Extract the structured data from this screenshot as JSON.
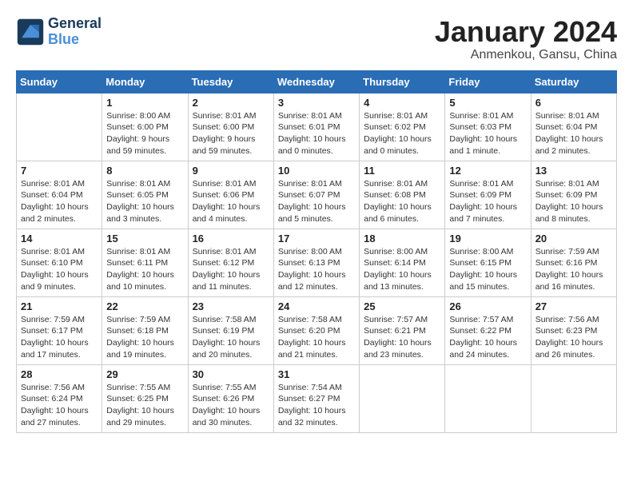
{
  "logo": {
    "line1": "General",
    "line2": "Blue"
  },
  "title": "January 2024",
  "subtitle": "Anmenkou, Gansu, China",
  "days_header": [
    "Sunday",
    "Monday",
    "Tuesday",
    "Wednesday",
    "Thursday",
    "Friday",
    "Saturday"
  ],
  "weeks": [
    [
      {
        "num": "",
        "info": ""
      },
      {
        "num": "1",
        "info": "Sunrise: 8:00 AM\nSunset: 6:00 PM\nDaylight: 9 hours\nand 59 minutes."
      },
      {
        "num": "2",
        "info": "Sunrise: 8:01 AM\nSunset: 6:00 PM\nDaylight: 9 hours\nand 59 minutes."
      },
      {
        "num": "3",
        "info": "Sunrise: 8:01 AM\nSunset: 6:01 PM\nDaylight: 10 hours\nand 0 minutes."
      },
      {
        "num": "4",
        "info": "Sunrise: 8:01 AM\nSunset: 6:02 PM\nDaylight: 10 hours\nand 0 minutes."
      },
      {
        "num": "5",
        "info": "Sunrise: 8:01 AM\nSunset: 6:03 PM\nDaylight: 10 hours\nand 1 minute."
      },
      {
        "num": "6",
        "info": "Sunrise: 8:01 AM\nSunset: 6:04 PM\nDaylight: 10 hours\nand 2 minutes."
      }
    ],
    [
      {
        "num": "7",
        "info": "Sunrise: 8:01 AM\nSunset: 6:04 PM\nDaylight: 10 hours\nand 2 minutes."
      },
      {
        "num": "8",
        "info": "Sunrise: 8:01 AM\nSunset: 6:05 PM\nDaylight: 10 hours\nand 3 minutes."
      },
      {
        "num": "9",
        "info": "Sunrise: 8:01 AM\nSunset: 6:06 PM\nDaylight: 10 hours\nand 4 minutes."
      },
      {
        "num": "10",
        "info": "Sunrise: 8:01 AM\nSunset: 6:07 PM\nDaylight: 10 hours\nand 5 minutes."
      },
      {
        "num": "11",
        "info": "Sunrise: 8:01 AM\nSunset: 6:08 PM\nDaylight: 10 hours\nand 6 minutes."
      },
      {
        "num": "12",
        "info": "Sunrise: 8:01 AM\nSunset: 6:09 PM\nDaylight: 10 hours\nand 7 minutes."
      },
      {
        "num": "13",
        "info": "Sunrise: 8:01 AM\nSunset: 6:09 PM\nDaylight: 10 hours\nand 8 minutes."
      }
    ],
    [
      {
        "num": "14",
        "info": "Sunrise: 8:01 AM\nSunset: 6:10 PM\nDaylight: 10 hours\nand 9 minutes."
      },
      {
        "num": "15",
        "info": "Sunrise: 8:01 AM\nSunset: 6:11 PM\nDaylight: 10 hours\nand 10 minutes."
      },
      {
        "num": "16",
        "info": "Sunrise: 8:01 AM\nSunset: 6:12 PM\nDaylight: 10 hours\nand 11 minutes."
      },
      {
        "num": "17",
        "info": "Sunrise: 8:00 AM\nSunset: 6:13 PM\nDaylight: 10 hours\nand 12 minutes."
      },
      {
        "num": "18",
        "info": "Sunrise: 8:00 AM\nSunset: 6:14 PM\nDaylight: 10 hours\nand 13 minutes."
      },
      {
        "num": "19",
        "info": "Sunrise: 8:00 AM\nSunset: 6:15 PM\nDaylight: 10 hours\nand 15 minutes."
      },
      {
        "num": "20",
        "info": "Sunrise: 7:59 AM\nSunset: 6:16 PM\nDaylight: 10 hours\nand 16 minutes."
      }
    ],
    [
      {
        "num": "21",
        "info": "Sunrise: 7:59 AM\nSunset: 6:17 PM\nDaylight: 10 hours\nand 17 minutes."
      },
      {
        "num": "22",
        "info": "Sunrise: 7:59 AM\nSunset: 6:18 PM\nDaylight: 10 hours\nand 19 minutes."
      },
      {
        "num": "23",
        "info": "Sunrise: 7:58 AM\nSunset: 6:19 PM\nDaylight: 10 hours\nand 20 minutes."
      },
      {
        "num": "24",
        "info": "Sunrise: 7:58 AM\nSunset: 6:20 PM\nDaylight: 10 hours\nand 21 minutes."
      },
      {
        "num": "25",
        "info": "Sunrise: 7:57 AM\nSunset: 6:21 PM\nDaylight: 10 hours\nand 23 minutes."
      },
      {
        "num": "26",
        "info": "Sunrise: 7:57 AM\nSunset: 6:22 PM\nDaylight: 10 hours\nand 24 minutes."
      },
      {
        "num": "27",
        "info": "Sunrise: 7:56 AM\nSunset: 6:23 PM\nDaylight: 10 hours\nand 26 minutes."
      }
    ],
    [
      {
        "num": "28",
        "info": "Sunrise: 7:56 AM\nSunset: 6:24 PM\nDaylight: 10 hours\nand 27 minutes."
      },
      {
        "num": "29",
        "info": "Sunrise: 7:55 AM\nSunset: 6:25 PM\nDaylight: 10 hours\nand 29 minutes."
      },
      {
        "num": "30",
        "info": "Sunrise: 7:55 AM\nSunset: 6:26 PM\nDaylight: 10 hours\nand 30 minutes."
      },
      {
        "num": "31",
        "info": "Sunrise: 7:54 AM\nSunset: 6:27 PM\nDaylight: 10 hours\nand 32 minutes."
      },
      {
        "num": "",
        "info": ""
      },
      {
        "num": "",
        "info": ""
      },
      {
        "num": "",
        "info": ""
      }
    ]
  ]
}
